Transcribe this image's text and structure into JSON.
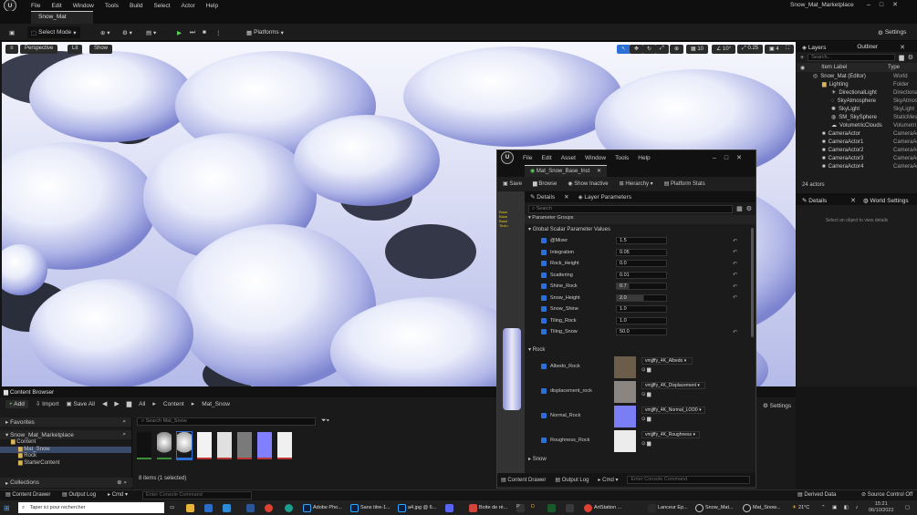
{
  "menu": {
    "items": [
      "File",
      "Edit",
      "Window",
      "Tools",
      "Build",
      "Select",
      "Actor",
      "Help"
    ],
    "project": "Snow_Mat_Marketplace"
  },
  "tab": {
    "title": "Snow_Mat"
  },
  "toolbar": {
    "select_mode": "Select Mode",
    "platforms": "Platforms",
    "settings": "Settings"
  },
  "viewport": {
    "perspective": "Perspective",
    "lit": "Lit",
    "show": "Show",
    "snap_value": "10",
    "angle_value": "10°",
    "scale_value": "0.25",
    "speed": "4"
  },
  "outliner": {
    "tab_layers": "Layers",
    "tab_outliner": "Outliner",
    "search_placeholder": "Search...",
    "col_label": "Item Label",
    "col_type": "Type",
    "rows": [
      {
        "label": "Snow_Mat (Editor)",
        "type": "World"
      },
      {
        "label": "Lighting",
        "type": "Folder"
      },
      {
        "label": "DirectionalLight",
        "type": "Directiona"
      },
      {
        "label": "SkyAtmosphere",
        "type": "SkyAtmos"
      },
      {
        "label": "SkyLight",
        "type": "SkyLight"
      },
      {
        "label": "SM_SkySphere",
        "type": "StaticMes"
      },
      {
        "label": "VolumetricClouds",
        "type": "Volumetri"
      },
      {
        "label": "CameraActor",
        "type": "CameraAc"
      },
      {
        "label": "CameraActor1",
        "type": "CameraAc"
      },
      {
        "label": "CameraActor2",
        "type": "CameraAc"
      },
      {
        "label": "CameraActor3",
        "type": "CameraAc"
      },
      {
        "label": "CameraActor4",
        "type": "CameraAc"
      }
    ],
    "count": "24 actors"
  },
  "details": {
    "tab_details": "Details",
    "tab_world": "World Settings",
    "empty": "Select an object to view details"
  },
  "matwin": {
    "menu": [
      "File",
      "Edit",
      "Asset",
      "Window",
      "Tools",
      "Help"
    ],
    "tab": "Mat_Snow_Base_Inst",
    "save": "Save",
    "browse": "Browse",
    "show_inactive": "Show Inactive",
    "hierarchy": "Hierarchy",
    "platform_stats": "Platform Stats",
    "tab_details": "Details",
    "tab_layer": "Layer Parameters",
    "search": "Search",
    "group_header": "Parameter Groups",
    "scalar_group": "Global Scalar Parameter Values",
    "scalars": [
      {
        "name": "@Mixer",
        "value": "1.5"
      },
      {
        "name": "Integration",
        "value": "0.05"
      },
      {
        "name": "Rock_Height",
        "value": "0.0"
      },
      {
        "name": "Scattering",
        "value": "0.01"
      },
      {
        "name": "Shine_Rock",
        "value": "0.7"
      },
      {
        "name": "Snow_Height",
        "value": "2.0"
      },
      {
        "name": "Snow_Shine",
        "value": "1.0"
      },
      {
        "name": "Tiling_Rock",
        "value": "1.0"
      },
      {
        "name": "Tiling_Snow",
        "value": "50.0"
      }
    ],
    "rock_group": "Rock",
    "textures": [
      {
        "name": "Albedo_Rock",
        "asset": "vmjjffy_4K_Albedo",
        "color": "#6b5d4a"
      },
      {
        "name": "displacement_rock",
        "asset": "vmjjffy_4K_Displacement",
        "color": "#8a8580"
      },
      {
        "name": "Normal_Rock",
        "asset": "vmjjffy_4K_Normal_LOD0",
        "color": "#7b7df4"
      },
      {
        "name": "Roughness_Rock",
        "asset": "vmjjffy_4K_Roughness",
        "color": "#ececec"
      }
    ],
    "snow_group": "Snow",
    "content_drawer": "Content Drawer",
    "output_log": "Output Log",
    "cmd": "Cmd",
    "console": "Enter Console Command"
  },
  "content_browser": {
    "tab": "Content Browser",
    "add": "Add",
    "import": "Import",
    "save_all": "Save All",
    "path": [
      "All",
      "Content",
      "Mat_Snow"
    ],
    "settings": "Settings",
    "favorites": "Favorites",
    "project": "Snow_Mat_Marketplace",
    "tree": [
      "Content",
      "Mat_Snow",
      "Rock",
      "StarterContent"
    ],
    "collections": "Collections",
    "search": "Search Mat_Snow",
    "status": "8 items (1 selected)",
    "assets": [
      "#101010",
      "#e6e6e6",
      "#dcdcdc",
      "#f2f2f2",
      "#7a7a7a",
      "#8080ff",
      "#f0f0f0",
      "#151515"
    ]
  },
  "statusbar": {
    "content_drawer": "Content Drawer",
    "output_log": "Output Log",
    "cmd": "Cmd",
    "console": "Enter Console Command",
    "derived": "Derived Data",
    "source": "Source Control Off"
  },
  "taskbar": {
    "search": "Taper ici pour rechercher",
    "apps": [
      "Adobe Pho...",
      "Sans titre-1...",
      "a4.jpg @ 6...",
      "Boite de ré...",
      "ArtStation ...",
      "Lanceur Ep...",
      "Snow_Mat...",
      "Mat_Snow..."
    ],
    "weather": "21°C",
    "time": "15:21",
    "date": "06/10/2022"
  }
}
